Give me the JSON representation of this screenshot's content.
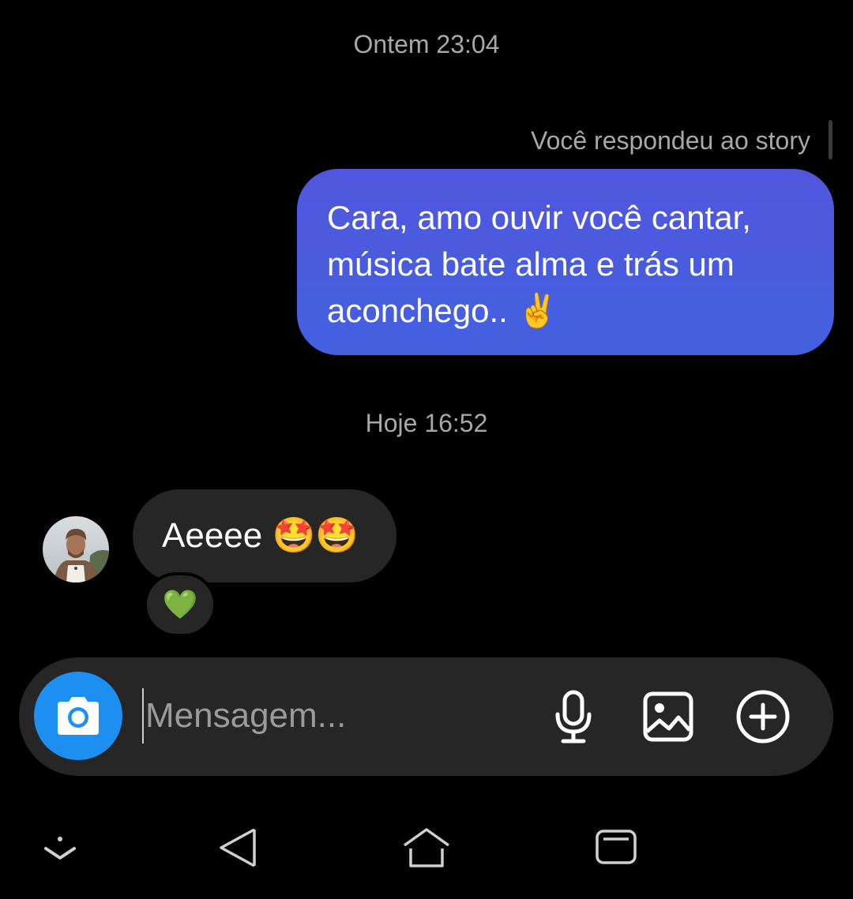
{
  "conversation": {
    "timestamp_1": "Ontem 23:04",
    "story_reply_label": "Você respondeu ao story",
    "sent_message": {
      "lines": [
        "Cara, amo ouvir você cantar,",
        "música bate alma e trás um",
        "aconchego.. ✌️"
      ]
    },
    "timestamp_2": "Hoje 16:52",
    "received_message": {
      "text": "Aeeee 🤩🤩",
      "reaction": "💚"
    }
  },
  "composer": {
    "placeholder": "Mensagem...",
    "camera_icon": "camera-icon",
    "mic_icon": "microphone-icon",
    "gallery_icon": "image-icon",
    "plus_icon": "plus-circle-icon"
  },
  "colors": {
    "sent_bubble_top": "#5156dd",
    "sent_bubble_bottom": "#4261e0",
    "received_bubble": "#262626",
    "camera_button": "#1d8ff2",
    "background": "#000000",
    "timestamp_text": "#a8a8a8"
  }
}
